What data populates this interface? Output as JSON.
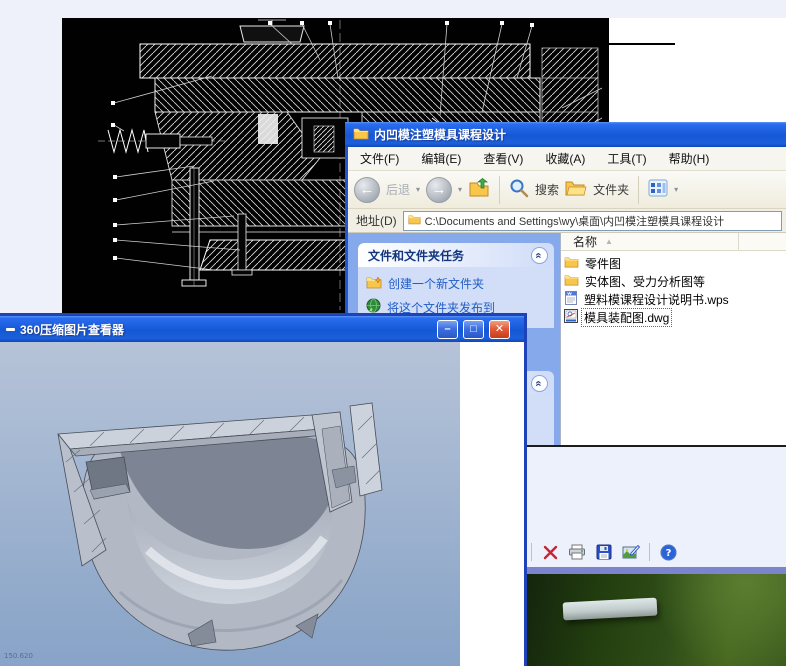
{
  "explorer": {
    "title": "内凹模注塑模具课程设计",
    "menu": [
      "文件(F)",
      "编辑(E)",
      "查看(V)",
      "收藏(A)",
      "工具(T)",
      "帮助(H)"
    ],
    "toolbar": {
      "back_label": "后退",
      "search_label": "搜索",
      "folders_label": "文件夹"
    },
    "address": {
      "label": "地址(D)",
      "value": "C:\\Documents and Settings\\wy\\桌面\\内凹模注塑模具课程设计"
    },
    "tasks": {
      "title": "文件和文件夹任务",
      "items": [
        "创建一个新文件夹",
        "将这个文件夹发布到"
      ]
    },
    "files": {
      "name_header": "名称",
      "items": [
        {
          "name": "零件图",
          "type": "folder"
        },
        {
          "name": "实体图、受力分析图等",
          "type": "folder"
        },
        {
          "name": "塑料模课程设计说明书.wps",
          "type": "wps"
        },
        {
          "name": "模具装配图.dwg",
          "type": "dwg",
          "selected": true
        }
      ]
    }
  },
  "viewer360": {
    "title": "360压缩图片查看器",
    "status_text": "150.620"
  },
  "picture_viewer": {
    "icons": [
      "delete",
      "print",
      "save",
      "edit-image",
      "help"
    ]
  },
  "colors": {
    "xp_blue": "#1557d4",
    "sidebar": "#85a9ea",
    "panel_body": "#d2ddf8",
    "link": "#215dc6",
    "photo_bar": "#7b84cc",
    "close_red": "#e25c38"
  }
}
